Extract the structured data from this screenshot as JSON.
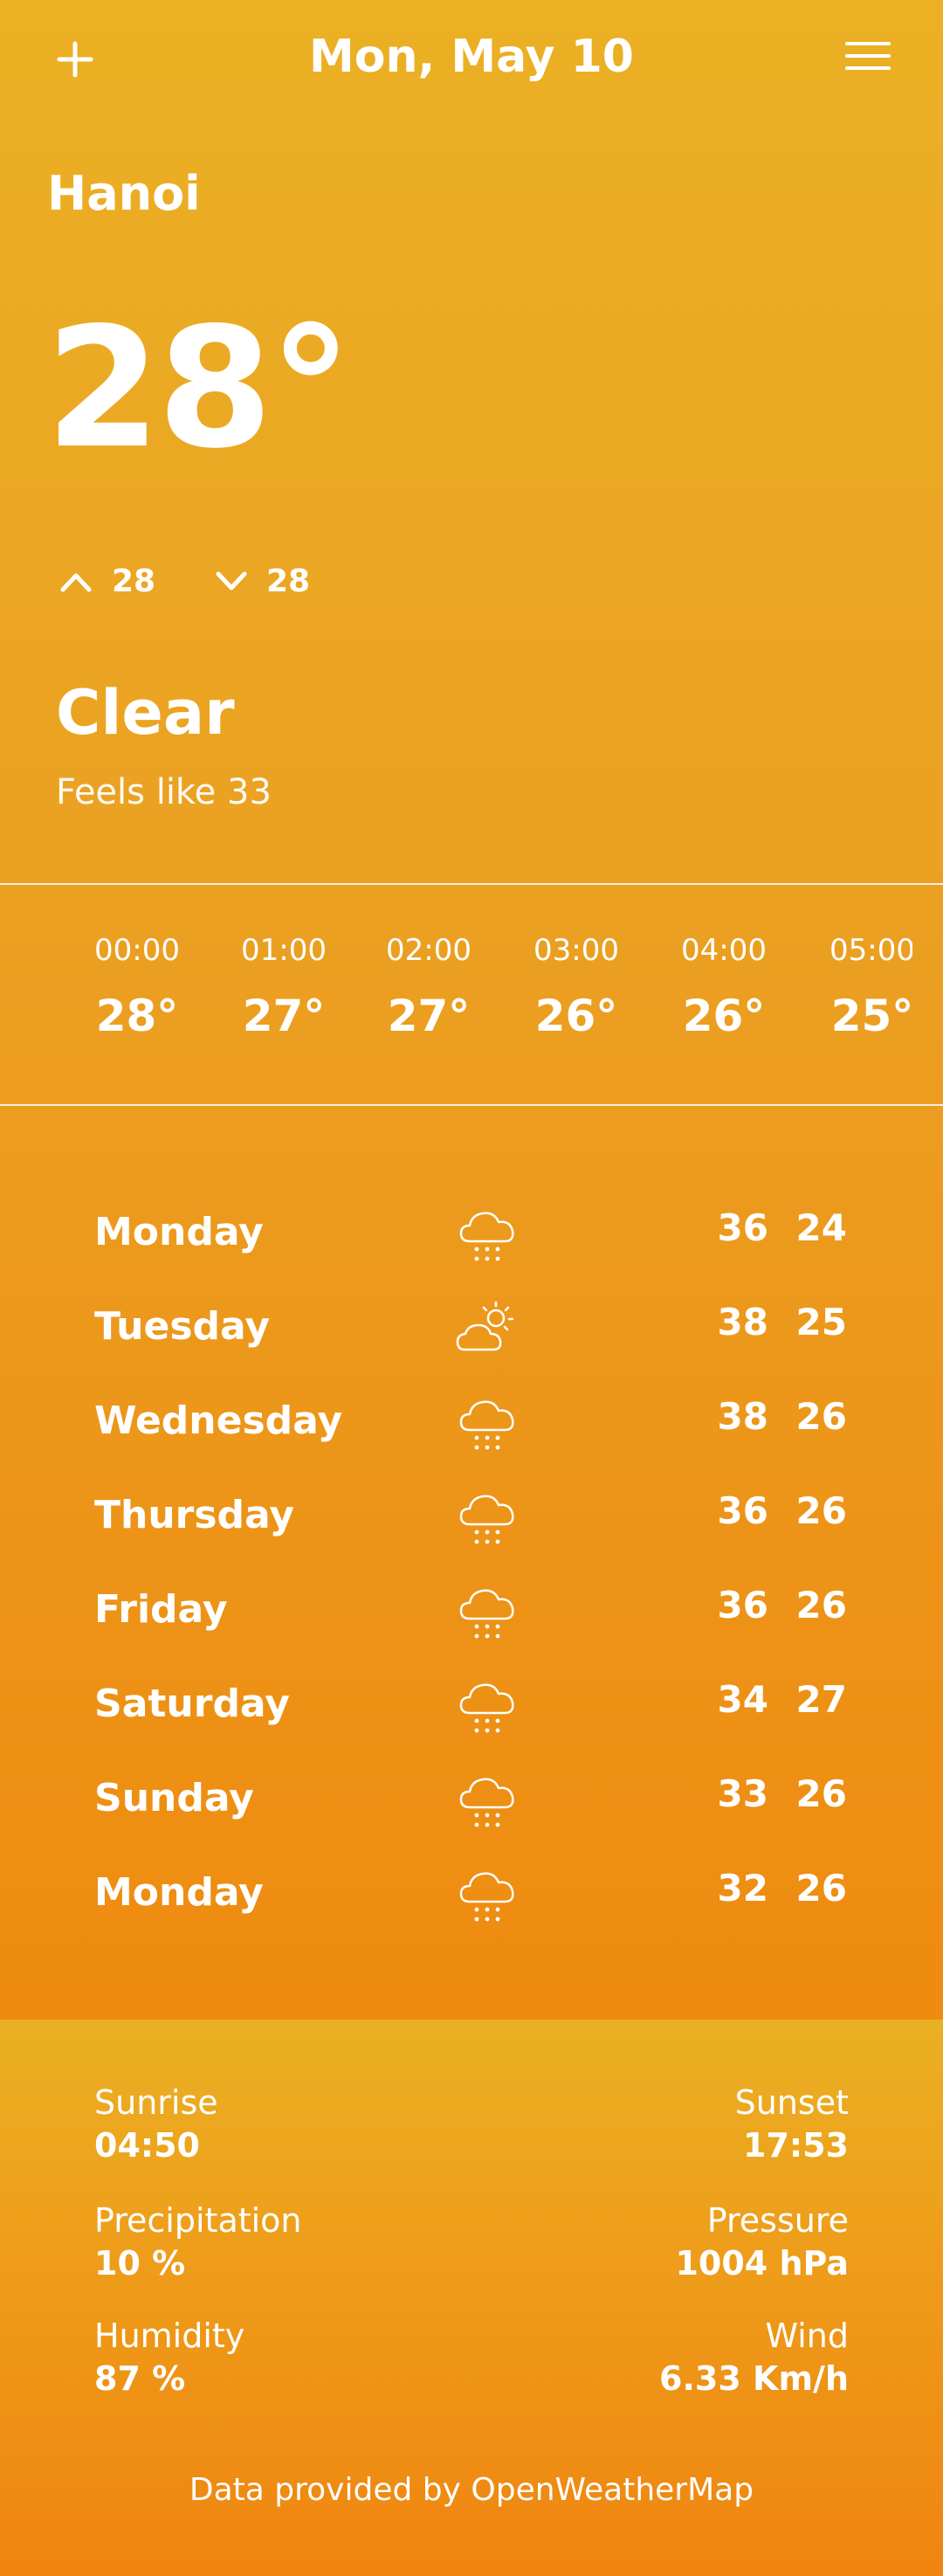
{
  "header": {
    "date": "Mon, May 10",
    "add_icon": "plus-icon",
    "menu_icon": "hamburger-menu-icon"
  },
  "current": {
    "city": "Hanoi",
    "temperature": "28°",
    "high": "28",
    "low": "28",
    "condition": "Clear",
    "feels_like": "Feels like 33"
  },
  "hourly": [
    {
      "time": "00:00",
      "temp": "28°"
    },
    {
      "time": "01:00",
      "temp": "27°"
    },
    {
      "time": "02:00",
      "temp": "27°"
    },
    {
      "time": "03:00",
      "temp": "26°"
    },
    {
      "time": "04:00",
      "temp": "26°"
    },
    {
      "time": "05:00",
      "temp": "25°"
    }
  ],
  "daily": [
    {
      "day": "Monday",
      "icon": "rain-cloud-icon",
      "high": "36",
      "low": "24"
    },
    {
      "day": "Tuesday",
      "icon": "partly-cloudy-sun-icon",
      "high": "38",
      "low": "25"
    },
    {
      "day": "Wednesday",
      "icon": "rain-cloud-icon",
      "high": "38",
      "low": "26"
    },
    {
      "day": "Thursday",
      "icon": "rain-cloud-icon",
      "high": "36",
      "low": "26"
    },
    {
      "day": "Friday",
      "icon": "rain-cloud-icon",
      "high": "36",
      "low": "26"
    },
    {
      "day": "Saturday",
      "icon": "rain-cloud-icon",
      "high": "34",
      "low": "27"
    },
    {
      "day": "Sunday",
      "icon": "rain-cloud-icon",
      "high": "33",
      "low": "26"
    },
    {
      "day": "Monday",
      "icon": "rain-cloud-icon",
      "high": "32",
      "low": "26"
    }
  ],
  "details": {
    "sunrise_label": "Sunrise",
    "sunrise": "04:50",
    "sunset_label": "Sunset",
    "sunset": "17:53",
    "precipitation_label": "Precipitation",
    "precipitation": "10 %",
    "pressure_label": "Pressure",
    "pressure": "1004 hPa",
    "humidity_label": "Humidity",
    "humidity": "87 %",
    "wind_label": "Wind",
    "wind": "6.33 Km/h"
  },
  "credit": "Data provided by OpenWeatherMap",
  "colors": {
    "bg_top": "#ebb024",
    "bg_bottom": "#ee8b10",
    "text": "#ffffff"
  }
}
